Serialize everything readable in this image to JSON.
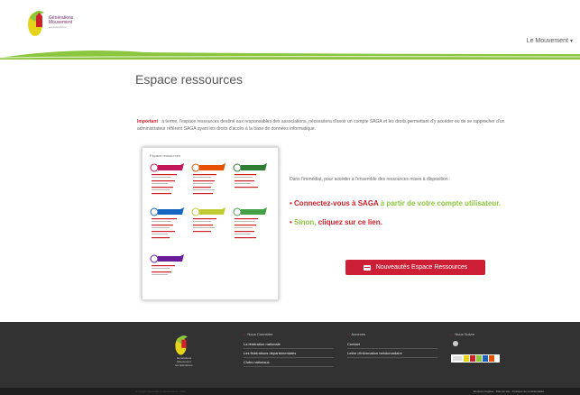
{
  "header": {
    "logo_lines": [
      "Générations",
      "Mouvement",
      "les fédérations"
    ],
    "menu_label": "Le Mouvement"
  },
  "main": {
    "title": "Espace ressources",
    "intro_important": "Important",
    "intro_text": " : à terme, l'espace ressources destiné aux responsables des associations, nécessitera d'avoir un compte SAGA et les droits permettant d'y accéder ou de se rapprocher d'un administrateur référent SAGA ayant les droits d'accès à la base de données informatique.",
    "thumbnail_title": "Espace ressources",
    "dans_text": "Dans l'immédiat, pour accéder à l'ensemble des ressources mises à disposition :",
    "link1_part1": "Connectez-vous à SAGA",
    "link1_part2": " à partir de votre compte utilisateur.",
    "link2_part1": "Sinon, ",
    "link2_part2": "cliquez sur ce lien.",
    "cta_label": "Nouveautés Espace Ressources"
  },
  "footer": {
    "logo_lines": [
      "Générations",
      "Mouvement",
      "les fédérations"
    ],
    "col1_title": "Nous Connaître",
    "col1_items": [
      "La fédération nationale",
      "Les fédérations départementales",
      "Clubs nationaux"
    ],
    "col2_title": "Annexes",
    "col2_items": [
      "Contact",
      "Lettre d'information hebdomadaire"
    ],
    "col3_title": "Nous Suivre",
    "copyright": "Copyright Générations Mouvement - 2020",
    "legal": "Mentions légales - Plan du site - Politique de confidentialité"
  },
  "colors": {
    "accent_red": "#cc1f36",
    "accent_green": "#8cc63f",
    "footer_bg": "#323232"
  }
}
